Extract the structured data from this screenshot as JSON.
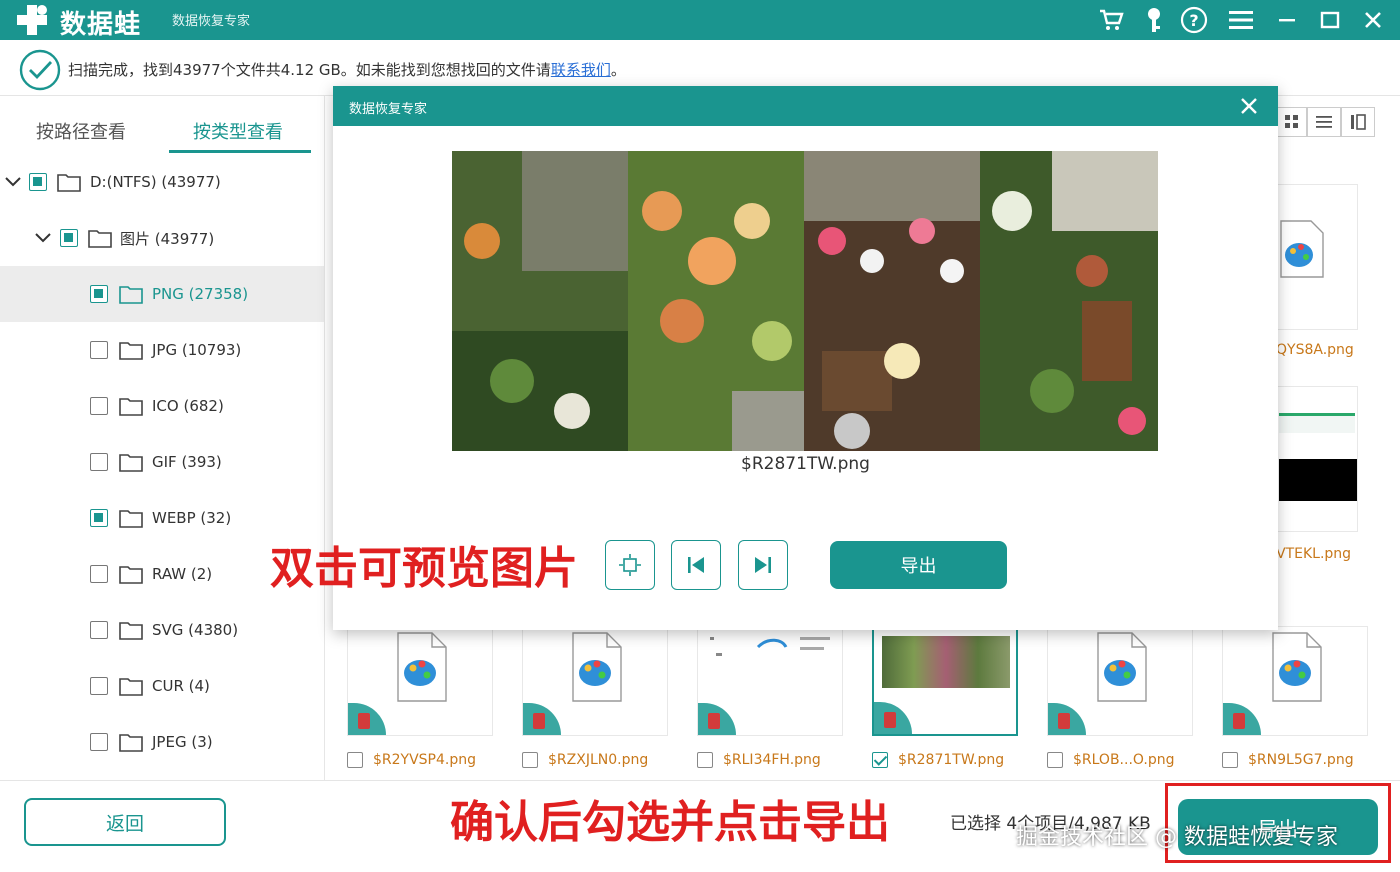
{
  "app": {
    "brand": "数据蛙",
    "subtitle": "数据恢复专家"
  },
  "status": {
    "message": "扫描完成，找到43977个文件共4.12 GB。如未能找到您想找回的文件请",
    "link": "联系我们",
    "suffix": "。"
  },
  "sidebar": {
    "tab_path": "按路径查看",
    "tab_type": "按类型查看",
    "tree": [
      {
        "label": "D:(NTFS) (43977)"
      },
      {
        "label": "图片 (43977)"
      },
      {
        "label": "PNG (27358)"
      },
      {
        "label": "JPG (10793)"
      },
      {
        "label": "ICO (682)"
      },
      {
        "label": "GIF (393)"
      },
      {
        "label": "WEBP (32)"
      },
      {
        "label": "RAW (2)"
      },
      {
        "label": "SVG (4380)"
      },
      {
        "label": "CUR (4)"
      },
      {
        "label": "JPEG (3)"
      }
    ]
  },
  "files": [
    {
      "name": "$R2YVSP4.png"
    },
    {
      "name": "$RZXJLN0.png"
    },
    {
      "name": "$RLI34FH.png"
    },
    {
      "name": "$R2871TW.png"
    },
    {
      "name": "$RLOB...O.png"
    },
    {
      "name": "$RN9L5G7.png"
    }
  ],
  "side_files": [
    {
      "name": "QYS8A.png"
    },
    {
      "name": "VTEKL.png"
    }
  ],
  "dialog": {
    "title": "数据恢复专家",
    "filename": "$R2871TW.png",
    "export": "导出"
  },
  "annotations": {
    "preview": "双击可预览图片",
    "export": "确认后勾选并点击导出"
  },
  "bottom": {
    "back": "返回",
    "selected": "已选择 4个项目/4,987 KB",
    "export": "导出",
    "watermark": "掘金技术社区 @ 数据蛙恢复专家"
  },
  "colors": {
    "teal": "#1a958f",
    "annotation_red": "#e02020",
    "filename_orange": "#c8781a"
  }
}
